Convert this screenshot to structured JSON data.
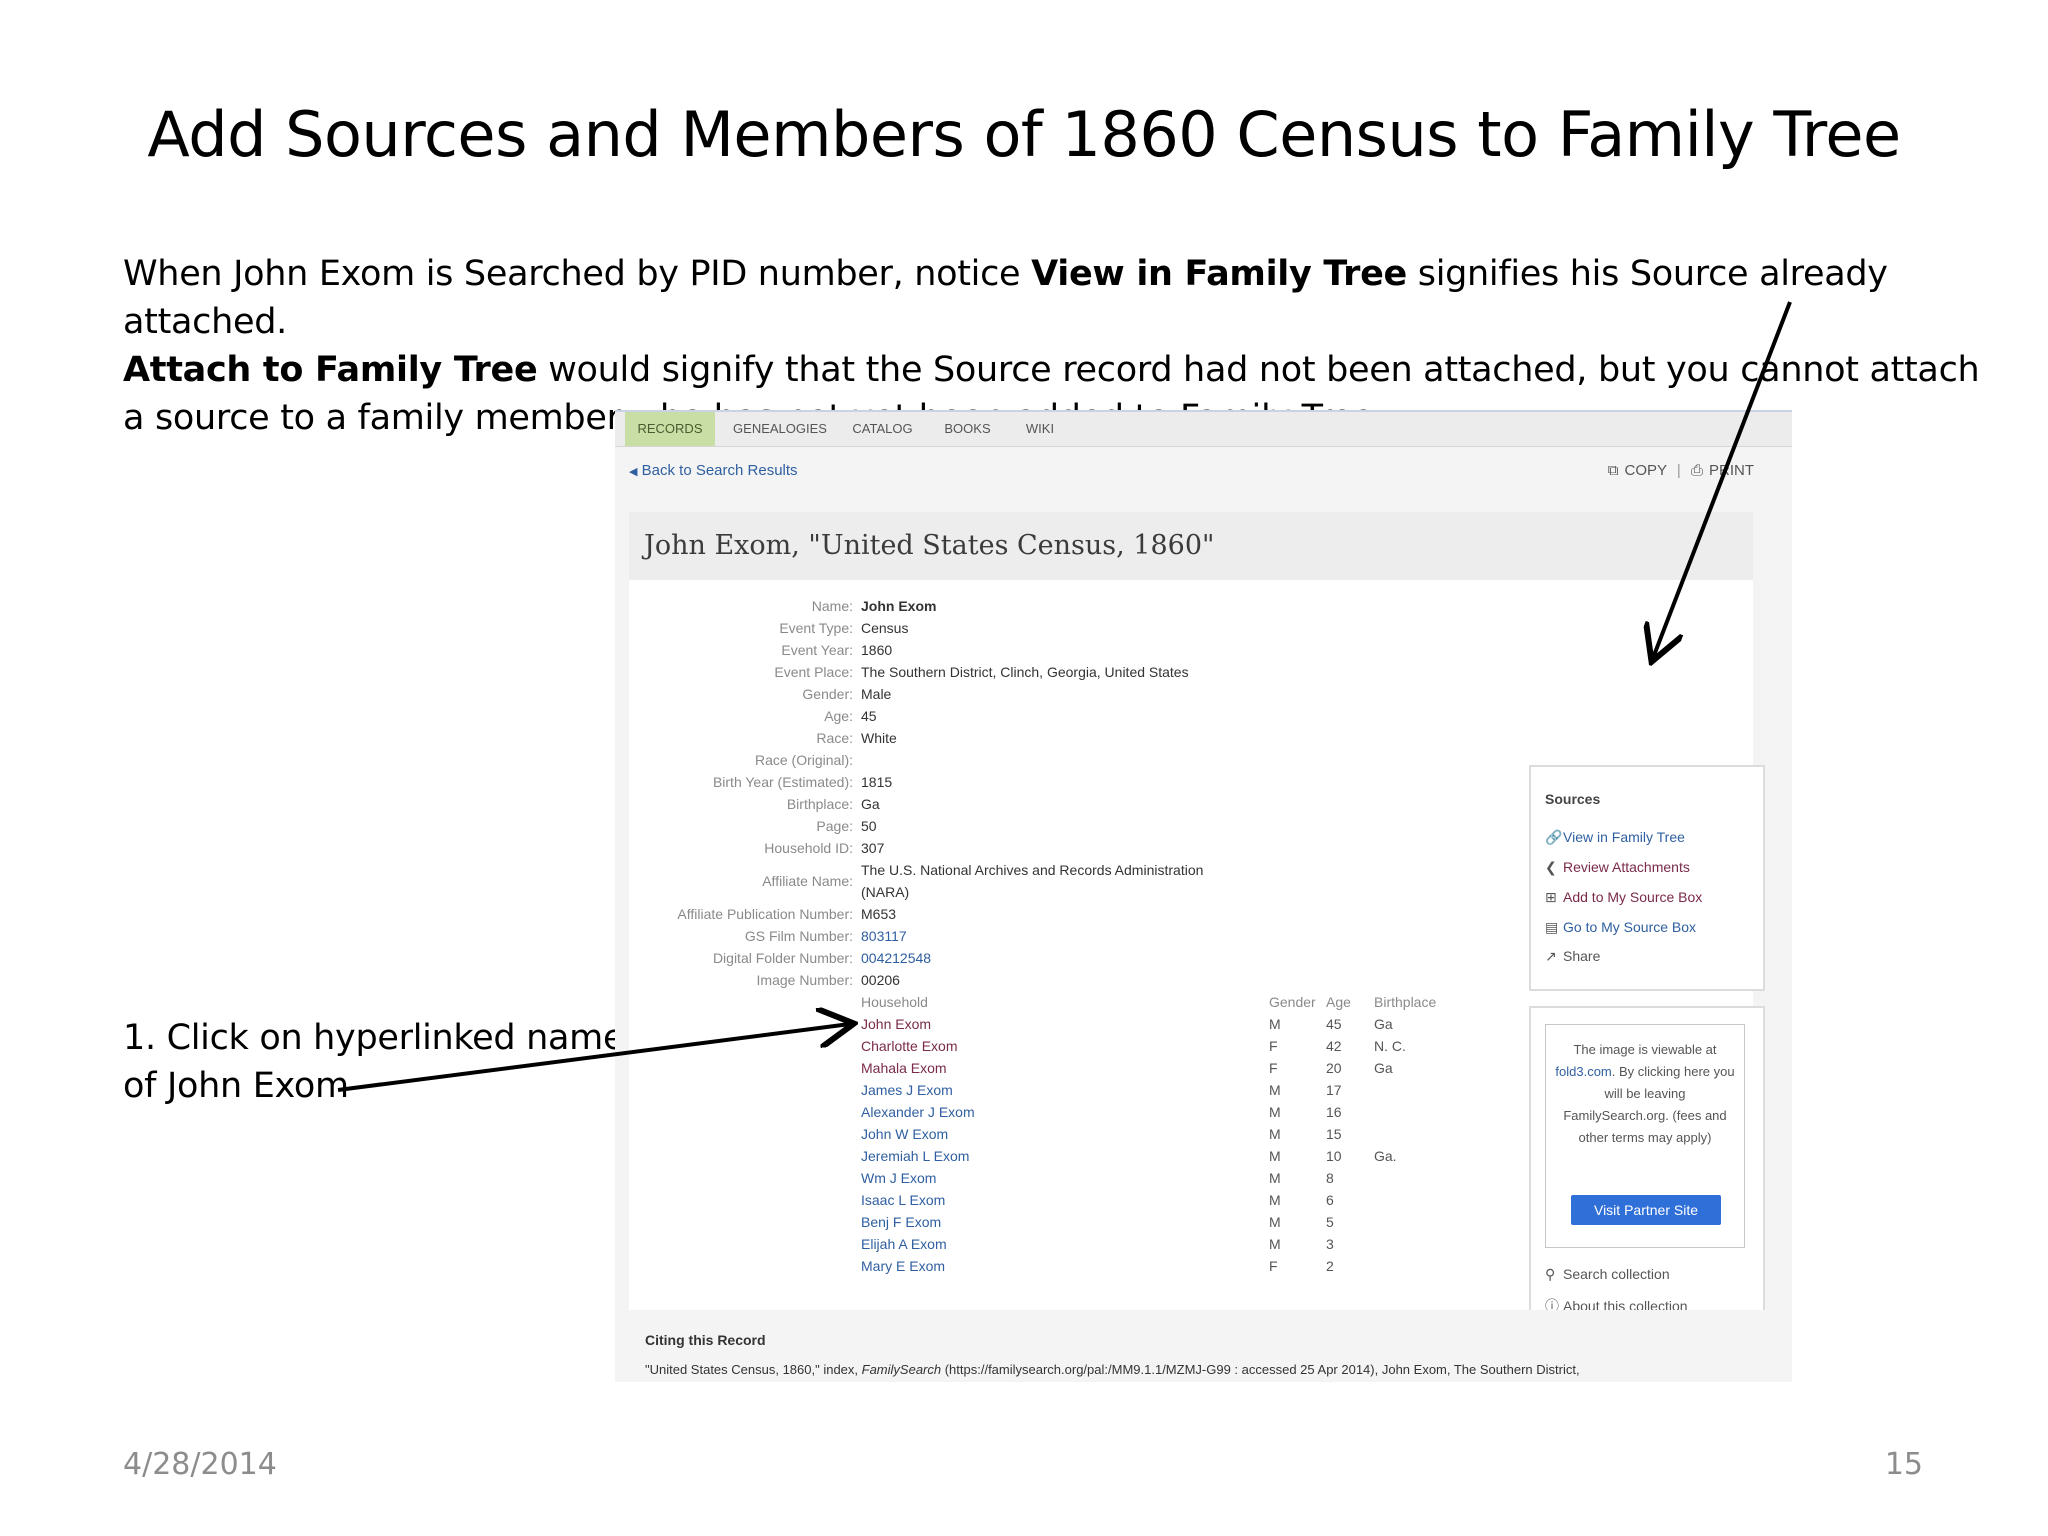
{
  "slide": {
    "title": "Add Sources and Members of 1860 Census to Family Tree",
    "intro_1": "When John Exom is Searched by PID number, notice ",
    "intro_bold_1": "View in Family Tree",
    "intro_2": " signifies his Source already attached.",
    "intro_bold_2": "Attach to Family Tree",
    "intro_3": " would signify that the Source record had not been attached, but you cannot attach a source to a family member who has not yet been added to Family Tree.",
    "step_note_line1": "1. Click on hyperlinked name",
    "step_note_line2": "of John Exom",
    "date": "4/28/2014",
    "page_number": "15"
  },
  "screenshot": {
    "tabs": [
      "RECORDS",
      "GENEALOGIES",
      "CATALOG",
      "BOOKS",
      "WIKI"
    ],
    "back_link": "Back to Search Results",
    "copy_label": "COPY",
    "print_label": "PRINT",
    "record_title": "John Exom, \"United States Census, 1860\"",
    "fields": [
      {
        "label": "Name:",
        "value": "John Exom",
        "bold": true
      },
      {
        "label": "Event Type:",
        "value": "Census"
      },
      {
        "label": "Event Year:",
        "value": "1860"
      },
      {
        "label": "Event Place:",
        "value": "The Southern District, Clinch, Georgia, United States"
      },
      {
        "label": "Gender:",
        "value": "Male"
      },
      {
        "label": "Age:",
        "value": "45"
      },
      {
        "label": "Race:",
        "value": "White"
      },
      {
        "label": "Race (Original):",
        "value": ""
      },
      {
        "label": "Birth Year (Estimated):",
        "value": "1815"
      },
      {
        "label": "Birthplace:",
        "value": "Ga"
      },
      {
        "label": "Page:",
        "value": "50"
      },
      {
        "label": "Household ID:",
        "value": "307"
      }
    ],
    "affiliate_label": "Affiliate Name:",
    "affiliate_line1": "The U.S. National Archives and Records Administration",
    "affiliate_line2": "(NARA)",
    "fields2": [
      {
        "label": "Affiliate Publication Number:",
        "value": "M653"
      },
      {
        "label": "GS Film Number:",
        "value": "803117",
        "link": true
      },
      {
        "label": "Digital Folder Number:",
        "value": "004212548",
        "link": true
      },
      {
        "label": "Image Number:",
        "value": "00206"
      }
    ],
    "household_headers": {
      "household": "Household",
      "gender": "Gender",
      "age": "Age",
      "birthplace": "Birthplace"
    },
    "household": [
      {
        "name": "John Exom",
        "gender": "M",
        "age": "45",
        "birthplace": "Ga",
        "visited": true
      },
      {
        "name": "Charlotte Exom",
        "gender": "F",
        "age": "42",
        "birthplace": "N. C.",
        "visited": true
      },
      {
        "name": "Mahala Exom",
        "gender": "F",
        "age": "20",
        "birthplace": "Ga",
        "visited": true
      },
      {
        "name": "James J Exom",
        "gender": "M",
        "age": "17",
        "birthplace": ""
      },
      {
        "name": "Alexander J Exom",
        "gender": "M",
        "age": "16",
        "birthplace": ""
      },
      {
        "name": "John W Exom",
        "gender": "M",
        "age": "15",
        "birthplace": ""
      },
      {
        "name": "Jeremiah L Exom",
        "gender": "M",
        "age": "10",
        "birthplace": "Ga."
      },
      {
        "name": "Wm J Exom",
        "gender": "M",
        "age": "8",
        "birthplace": ""
      },
      {
        "name": "Isaac L Exom",
        "gender": "M",
        "age": "6",
        "birthplace": ""
      },
      {
        "name": "Benj F Exom",
        "gender": "M",
        "age": "5",
        "birthplace": ""
      },
      {
        "name": "Elijah A Exom",
        "gender": "M",
        "age": "3",
        "birthplace": ""
      },
      {
        "name": "Mary E Exom",
        "gender": "F",
        "age": "2",
        "birthplace": ""
      }
    ],
    "sources": {
      "title": "Sources",
      "view_in_tree": "View in Family Tree",
      "review_attachments": "Review Attachments",
      "add_source_box": "Add to My Source Box",
      "go_source_box": "Go to My Source Box",
      "share": "Share"
    },
    "partner": {
      "text_1": "The image is viewable at",
      "link": "fold3.com",
      "text_2": ". By clicking here you will be leaving FamilySearch.org. (fees and other terms may apply)",
      "button": "Visit Partner Site",
      "search_collection": "Search collection",
      "about_collection": "About this collection"
    },
    "citation": {
      "title": "Citing this Record",
      "text_1": "\"United States Census, 1860,\" index, ",
      "text_italic": "FamilySearch",
      "text_2": " (https://familysearch.org/pal:/MM9.1.1/MZMJ-G99 : accessed 25 Apr 2014), John Exom, The Southern District,"
    }
  }
}
